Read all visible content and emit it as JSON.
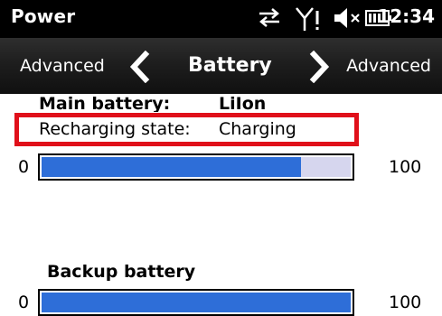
{
  "statusbar": {
    "app_title": "Power",
    "time": "12:34",
    "icons": [
      "sync-arrows-icon",
      "signal-no-service-icon",
      "speaker-muted-icon",
      "battery-icon"
    ]
  },
  "navbar": {
    "left_link": "Advanced",
    "title": "Battery",
    "right_link": "Advanced"
  },
  "main_battery": {
    "label": "Main battery:",
    "type": "LiIon",
    "state_label": "Recharging state:",
    "state_value": "Charging",
    "min_label": "0",
    "max_label": "100",
    "level_percent": 84
  },
  "backup_battery": {
    "label": "Backup battery",
    "min_label": "0",
    "max_label": "100",
    "level_percent": 100
  },
  "colors": {
    "bar_fill": "#2e6ed8",
    "bar_empty": "#d6d6ee",
    "highlight": "#e0101a"
  }
}
